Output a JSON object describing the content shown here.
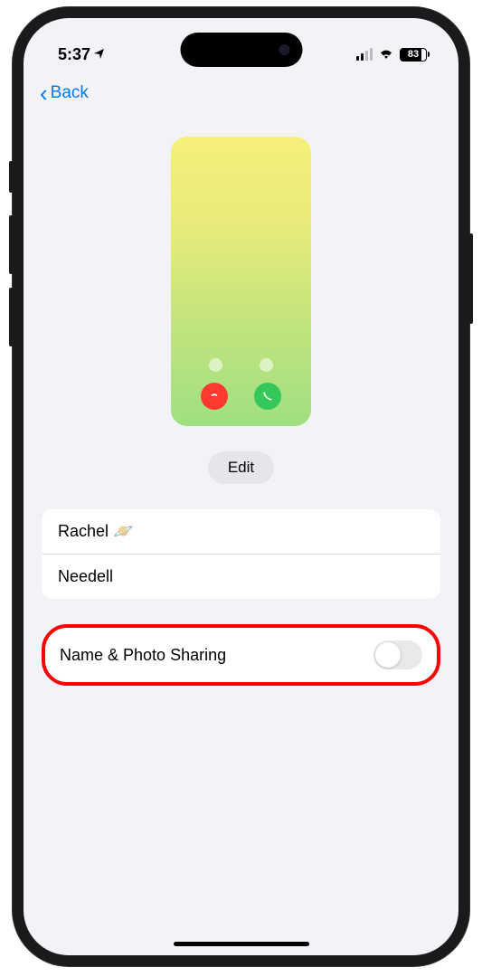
{
  "status": {
    "time": "5:37",
    "battery_pct": "83"
  },
  "nav": {
    "back_label": "Back"
  },
  "edit": {
    "label": "Edit"
  },
  "name": {
    "first": "Rachel 🪐",
    "last": "Needell"
  },
  "sharing": {
    "label": "Name & Photo Sharing",
    "enabled": false
  }
}
